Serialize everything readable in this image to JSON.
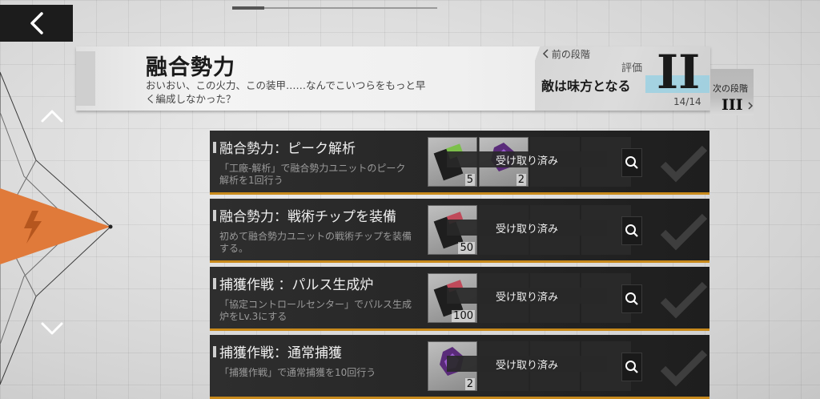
{
  "header": {
    "title": "融合勢力",
    "description": "おいおい、この火力、この装甲……なんでこいつらをもっと早く編成しなかった？",
    "prev_stage_label": "前の段階",
    "eval_label": "評価",
    "eval_stage_name": "敵は味方となる",
    "eval_roman": "II",
    "progress": "14/14",
    "next_stage_label": "次の段階",
    "next_roman": "III"
  },
  "tasks": [
    {
      "title": "融合勢力：ピーク解析",
      "desc": "「工廠-解析」で融合勢力ユニットのピーク解析を1回行う",
      "items": [
        {
          "icon": "chip-green-icon",
          "count": "5"
        },
        {
          "icon": "crystal-purple-icon",
          "count": "2"
        }
      ],
      "status": "受け取り済み"
    },
    {
      "title": "融合勢力：戦術チップを装備",
      "desc": "初めて融合勢力ユニットの戦術チップを装備する。",
      "items": [
        {
          "icon": "chip-red-icon",
          "count": "50"
        }
      ],
      "status": "受け取り済み"
    },
    {
      "title": "捕獲作戦 ：パルス生成炉",
      "desc": "「協定コントロールセンター」でパルス生成炉をLv.3にする",
      "items": [
        {
          "icon": "chip-red-icon",
          "count": "100"
        }
      ],
      "status": "受け取り済み"
    },
    {
      "title": "捕獲作戦：通常捕獲",
      "desc": "「捕獲作戦」で通常捕獲を10回行う",
      "items": [
        {
          "icon": "crystal-purple-icon",
          "count": "2"
        }
      ],
      "status": "受け取り済み"
    }
  ],
  "colors": {
    "accent_orange": "#e07a3a",
    "row_border": "#c88a1c",
    "eval_highlight": "#8fd0e6"
  }
}
